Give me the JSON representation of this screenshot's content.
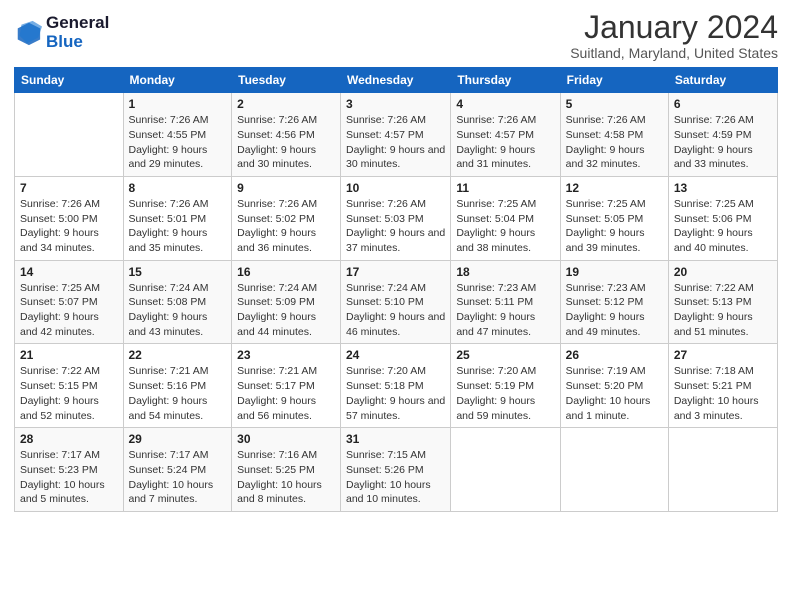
{
  "logo": {
    "line1": "General",
    "line2": "Blue"
  },
  "title": "January 2024",
  "subtitle": "Suitland, Maryland, United States",
  "days_header": [
    "Sunday",
    "Monday",
    "Tuesday",
    "Wednesday",
    "Thursday",
    "Friday",
    "Saturday"
  ],
  "weeks": [
    [
      {
        "day": "",
        "sunrise": "",
        "sunset": "",
        "daylight": ""
      },
      {
        "day": "1",
        "sunrise": "Sunrise: 7:26 AM",
        "sunset": "Sunset: 4:55 PM",
        "daylight": "Daylight: 9 hours and 29 minutes."
      },
      {
        "day": "2",
        "sunrise": "Sunrise: 7:26 AM",
        "sunset": "Sunset: 4:56 PM",
        "daylight": "Daylight: 9 hours and 30 minutes."
      },
      {
        "day": "3",
        "sunrise": "Sunrise: 7:26 AM",
        "sunset": "Sunset: 4:57 PM",
        "daylight": "Daylight: 9 hours and 30 minutes."
      },
      {
        "day": "4",
        "sunrise": "Sunrise: 7:26 AM",
        "sunset": "Sunset: 4:57 PM",
        "daylight": "Daylight: 9 hours and 31 minutes."
      },
      {
        "day": "5",
        "sunrise": "Sunrise: 7:26 AM",
        "sunset": "Sunset: 4:58 PM",
        "daylight": "Daylight: 9 hours and 32 minutes."
      },
      {
        "day": "6",
        "sunrise": "Sunrise: 7:26 AM",
        "sunset": "Sunset: 4:59 PM",
        "daylight": "Daylight: 9 hours and 33 minutes."
      }
    ],
    [
      {
        "day": "7",
        "sunrise": "Sunrise: 7:26 AM",
        "sunset": "Sunset: 5:00 PM",
        "daylight": "Daylight: 9 hours and 34 minutes."
      },
      {
        "day": "8",
        "sunrise": "Sunrise: 7:26 AM",
        "sunset": "Sunset: 5:01 PM",
        "daylight": "Daylight: 9 hours and 35 minutes."
      },
      {
        "day": "9",
        "sunrise": "Sunrise: 7:26 AM",
        "sunset": "Sunset: 5:02 PM",
        "daylight": "Daylight: 9 hours and 36 minutes."
      },
      {
        "day": "10",
        "sunrise": "Sunrise: 7:26 AM",
        "sunset": "Sunset: 5:03 PM",
        "daylight": "Daylight: 9 hours and 37 minutes."
      },
      {
        "day": "11",
        "sunrise": "Sunrise: 7:25 AM",
        "sunset": "Sunset: 5:04 PM",
        "daylight": "Daylight: 9 hours and 38 minutes."
      },
      {
        "day": "12",
        "sunrise": "Sunrise: 7:25 AM",
        "sunset": "Sunset: 5:05 PM",
        "daylight": "Daylight: 9 hours and 39 minutes."
      },
      {
        "day": "13",
        "sunrise": "Sunrise: 7:25 AM",
        "sunset": "Sunset: 5:06 PM",
        "daylight": "Daylight: 9 hours and 40 minutes."
      }
    ],
    [
      {
        "day": "14",
        "sunrise": "Sunrise: 7:25 AM",
        "sunset": "Sunset: 5:07 PM",
        "daylight": "Daylight: 9 hours and 42 minutes."
      },
      {
        "day": "15",
        "sunrise": "Sunrise: 7:24 AM",
        "sunset": "Sunset: 5:08 PM",
        "daylight": "Daylight: 9 hours and 43 minutes."
      },
      {
        "day": "16",
        "sunrise": "Sunrise: 7:24 AM",
        "sunset": "Sunset: 5:09 PM",
        "daylight": "Daylight: 9 hours and 44 minutes."
      },
      {
        "day": "17",
        "sunrise": "Sunrise: 7:24 AM",
        "sunset": "Sunset: 5:10 PM",
        "daylight": "Daylight: 9 hours and 46 minutes."
      },
      {
        "day": "18",
        "sunrise": "Sunrise: 7:23 AM",
        "sunset": "Sunset: 5:11 PM",
        "daylight": "Daylight: 9 hours and 47 minutes."
      },
      {
        "day": "19",
        "sunrise": "Sunrise: 7:23 AM",
        "sunset": "Sunset: 5:12 PM",
        "daylight": "Daylight: 9 hours and 49 minutes."
      },
      {
        "day": "20",
        "sunrise": "Sunrise: 7:22 AM",
        "sunset": "Sunset: 5:13 PM",
        "daylight": "Daylight: 9 hours and 51 minutes."
      }
    ],
    [
      {
        "day": "21",
        "sunrise": "Sunrise: 7:22 AM",
        "sunset": "Sunset: 5:15 PM",
        "daylight": "Daylight: 9 hours and 52 minutes."
      },
      {
        "day": "22",
        "sunrise": "Sunrise: 7:21 AM",
        "sunset": "Sunset: 5:16 PM",
        "daylight": "Daylight: 9 hours and 54 minutes."
      },
      {
        "day": "23",
        "sunrise": "Sunrise: 7:21 AM",
        "sunset": "Sunset: 5:17 PM",
        "daylight": "Daylight: 9 hours and 56 minutes."
      },
      {
        "day": "24",
        "sunrise": "Sunrise: 7:20 AM",
        "sunset": "Sunset: 5:18 PM",
        "daylight": "Daylight: 9 hours and 57 minutes."
      },
      {
        "day": "25",
        "sunrise": "Sunrise: 7:20 AM",
        "sunset": "Sunset: 5:19 PM",
        "daylight": "Daylight: 9 hours and 59 minutes."
      },
      {
        "day": "26",
        "sunrise": "Sunrise: 7:19 AM",
        "sunset": "Sunset: 5:20 PM",
        "daylight": "Daylight: 10 hours and 1 minute."
      },
      {
        "day": "27",
        "sunrise": "Sunrise: 7:18 AM",
        "sunset": "Sunset: 5:21 PM",
        "daylight": "Daylight: 10 hours and 3 minutes."
      }
    ],
    [
      {
        "day": "28",
        "sunrise": "Sunrise: 7:17 AM",
        "sunset": "Sunset: 5:23 PM",
        "daylight": "Daylight: 10 hours and 5 minutes."
      },
      {
        "day": "29",
        "sunrise": "Sunrise: 7:17 AM",
        "sunset": "Sunset: 5:24 PM",
        "daylight": "Daylight: 10 hours and 7 minutes."
      },
      {
        "day": "30",
        "sunrise": "Sunrise: 7:16 AM",
        "sunset": "Sunset: 5:25 PM",
        "daylight": "Daylight: 10 hours and 8 minutes."
      },
      {
        "day": "31",
        "sunrise": "Sunrise: 7:15 AM",
        "sunset": "Sunset: 5:26 PM",
        "daylight": "Daylight: 10 hours and 10 minutes."
      },
      {
        "day": "",
        "sunrise": "",
        "sunset": "",
        "daylight": ""
      },
      {
        "day": "",
        "sunrise": "",
        "sunset": "",
        "daylight": ""
      },
      {
        "day": "",
        "sunrise": "",
        "sunset": "",
        "daylight": ""
      }
    ]
  ]
}
